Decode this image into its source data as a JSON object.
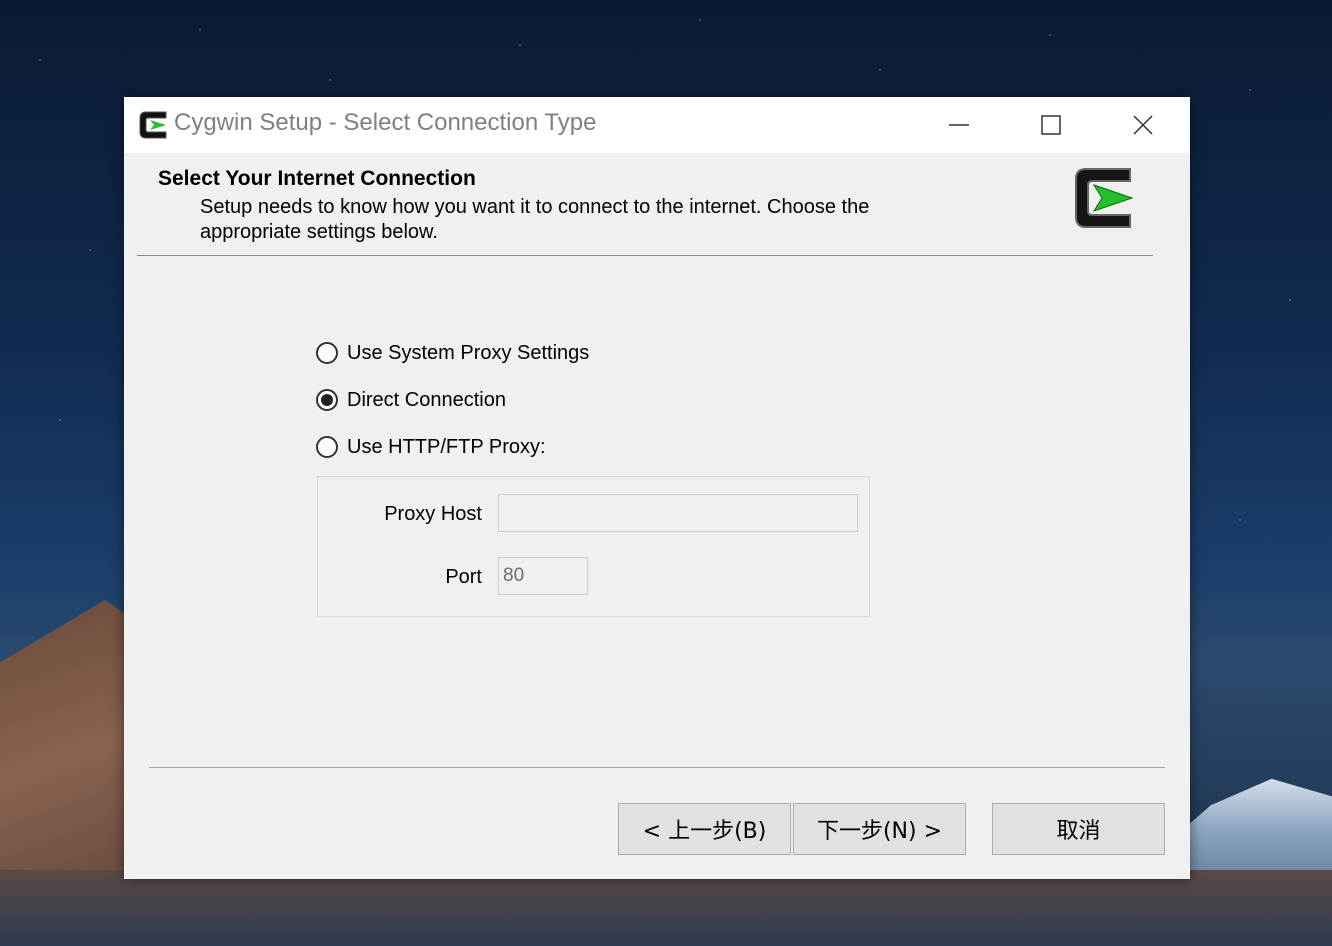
{
  "window": {
    "title": "Cygwin Setup - Select Connection Type",
    "controls": [
      "minimize-icon",
      "maximize-icon",
      "close-icon"
    ]
  },
  "header": {
    "title": "Select Your Internet Connection",
    "description": "Setup needs to know how you want it to connect to the internet.  Choose the appropriate settings below."
  },
  "options": [
    {
      "label": "Use System Proxy Settings",
      "selected": false
    },
    {
      "label": "Direct Connection",
      "selected": true
    },
    {
      "label": "Use HTTP/FTP Proxy:",
      "selected": false
    }
  ],
  "proxy": {
    "host_label": "Proxy Host",
    "host_value": "",
    "port_label": "Port",
    "port_value": "80"
  },
  "buttons": {
    "back": "< 上一步(B)",
    "next": "下一步(N) >",
    "cancel": "取消"
  },
  "colors": {
    "logo_green": "#22c02a",
    "window_bg": "#f0f0f0"
  }
}
